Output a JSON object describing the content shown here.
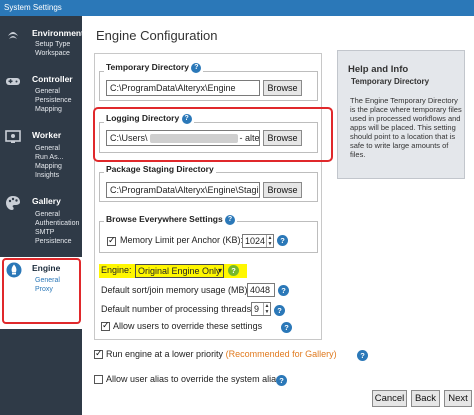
{
  "window": {
    "title": "System Settings"
  },
  "sidebar": {
    "groups": [
      {
        "title": "Environment",
        "icon": "gear-icon",
        "items": [
          "Setup Type",
          "Workspace"
        ]
      },
      {
        "title": "Controller",
        "icon": "gamepad-icon",
        "items": [
          "General",
          "Persistence",
          "Mapping"
        ]
      },
      {
        "title": "Worker",
        "icon": "monitor-icon",
        "items": [
          "General",
          "Run As...",
          "Mapping",
          "Insights"
        ]
      },
      {
        "title": "Gallery",
        "icon": "palette-icon",
        "items": [
          "General",
          "Authentication",
          "SMTP",
          "Persistence"
        ]
      },
      {
        "title": "Engine",
        "icon": "engine-icon",
        "items": [
          "General",
          "Proxy"
        ],
        "active": true
      }
    ]
  },
  "main": {
    "title": "Engine Configuration",
    "temp_dir": {
      "legend": "Temporary Directory",
      "value": "C:\\ProgramData\\Alteryx\\Engine",
      "browse": "Browse"
    },
    "logging_dir": {
      "legend": "Logging Directory",
      "value_start": "C:\\Users\\",
      "value_end": "- alter",
      "browse": "Browse"
    },
    "staging_dir": {
      "legend": "Package Staging Directory",
      "value": "C:\\ProgramData\\Alteryx\\Engine\\Staging",
      "browse": "Browse"
    },
    "browse_everywhere": {
      "legend": "Browse Everywhere Settings",
      "memory_label": "Memory Limit per Anchor (KB):",
      "memory_value": "1024",
      "memory_checked": true
    },
    "engine": {
      "label": "Engine:",
      "selected": "Original Engine Only"
    },
    "sort_join": {
      "label": "Default sort/join memory usage (MB):",
      "value": "4048"
    },
    "threads": {
      "label": "Default number of processing threads:",
      "value": "9"
    },
    "override": {
      "label": "Allow users to override these settings",
      "checked": true
    },
    "low_priority": {
      "label": "Run engine at a lower priority",
      "note": "(Recommended for Gallery)",
      "checked": true
    },
    "user_alias": {
      "label": "Allow user alias to override the system alias",
      "checked": false
    }
  },
  "help": {
    "title": "Help and Info",
    "subtitle": "Temporary Directory",
    "body": "The Engine Temporary Directory is the place where temporary files used in processed workflows and apps will be placed. This setting should point to a location that is safe to write large amounts of files."
  },
  "footer": {
    "cancel": "Cancel",
    "back": "Back",
    "next": "Next"
  },
  "colors": {
    "sidebar_bg": "#2f3a47",
    "accent": "#2b78b8",
    "highlight": "#e0282b",
    "engine_highlight": "#fff700"
  }
}
